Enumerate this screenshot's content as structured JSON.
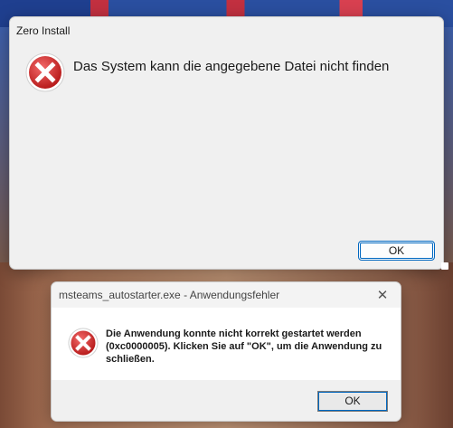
{
  "dialog1": {
    "title": "Zero Install",
    "message": "Das System kann die angegebene Datei nicht finden",
    "icon": "error-icon",
    "ok_label": "OK"
  },
  "dialog2": {
    "title": "msteams_autostarter.exe - Anwendungsfehler",
    "message": "Die Anwendung konnte nicht korrekt gestartet werden (0xc0000005). Klicken Sie auf \"OK\", um die Anwendung zu schließen.",
    "icon": "error-icon",
    "close_glyph": "✕",
    "ok_label": "OK"
  },
  "colors": {
    "error_red": "#d32f2f",
    "accent": "#0067c0"
  }
}
